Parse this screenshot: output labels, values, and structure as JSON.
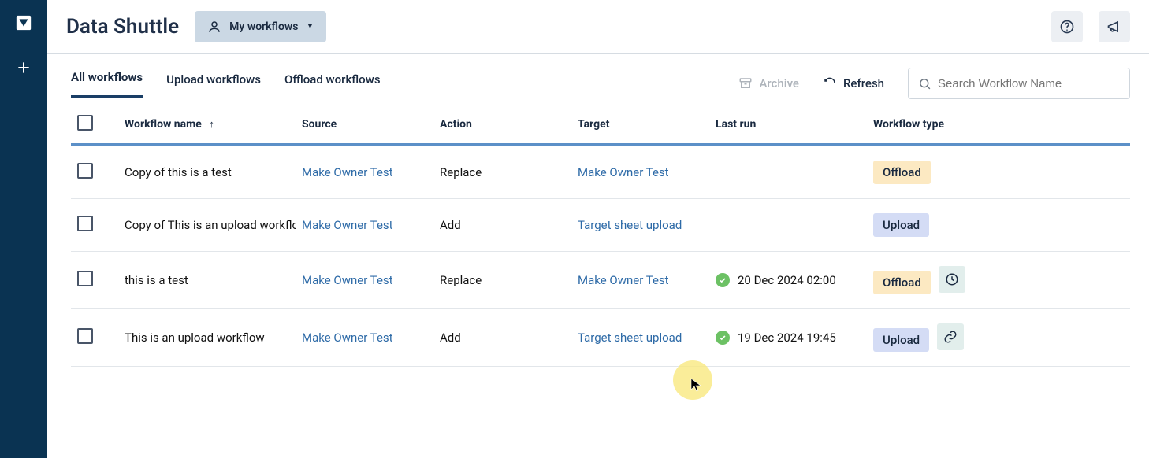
{
  "app": {
    "title": "Data Shuttle"
  },
  "dropdown": {
    "label": "My workflows"
  },
  "tabs": {
    "all": "All workflows",
    "upload": "Upload workflows",
    "offload": "Offload workflows"
  },
  "actions": {
    "archive": "Archive",
    "refresh": "Refresh"
  },
  "search": {
    "placeholder": "Search Workflow Name"
  },
  "columns": {
    "name": "Workflow name",
    "source": "Source",
    "action": "Action",
    "target": "Target",
    "lastrun": "Last run",
    "type": "Workflow type"
  },
  "rows": [
    {
      "name": "Copy of this is a test",
      "source": "Make Owner Test",
      "action": "Replace",
      "target": "Make Owner Test",
      "lastrun": "",
      "status": "",
      "type": "Offload",
      "extra": ""
    },
    {
      "name": "Copy of This is an upload workflow",
      "source": "Make Owner Test",
      "action": "Add",
      "target": "Target sheet upload",
      "lastrun": "",
      "status": "",
      "type": "Upload",
      "extra": ""
    },
    {
      "name": "this is a test",
      "source": "Make Owner Test",
      "action": "Replace",
      "target": "Make Owner Test",
      "lastrun": "20 Dec 2024 02:00",
      "status": "ok",
      "type": "Offload",
      "extra": "clock"
    },
    {
      "name": "This is an upload workflow",
      "source": "Make Owner Test",
      "action": "Add",
      "target": "Target sheet upload",
      "lastrun": "19 Dec 2024 19:45",
      "status": "ok",
      "type": "Upload",
      "extra": "link"
    }
  ]
}
